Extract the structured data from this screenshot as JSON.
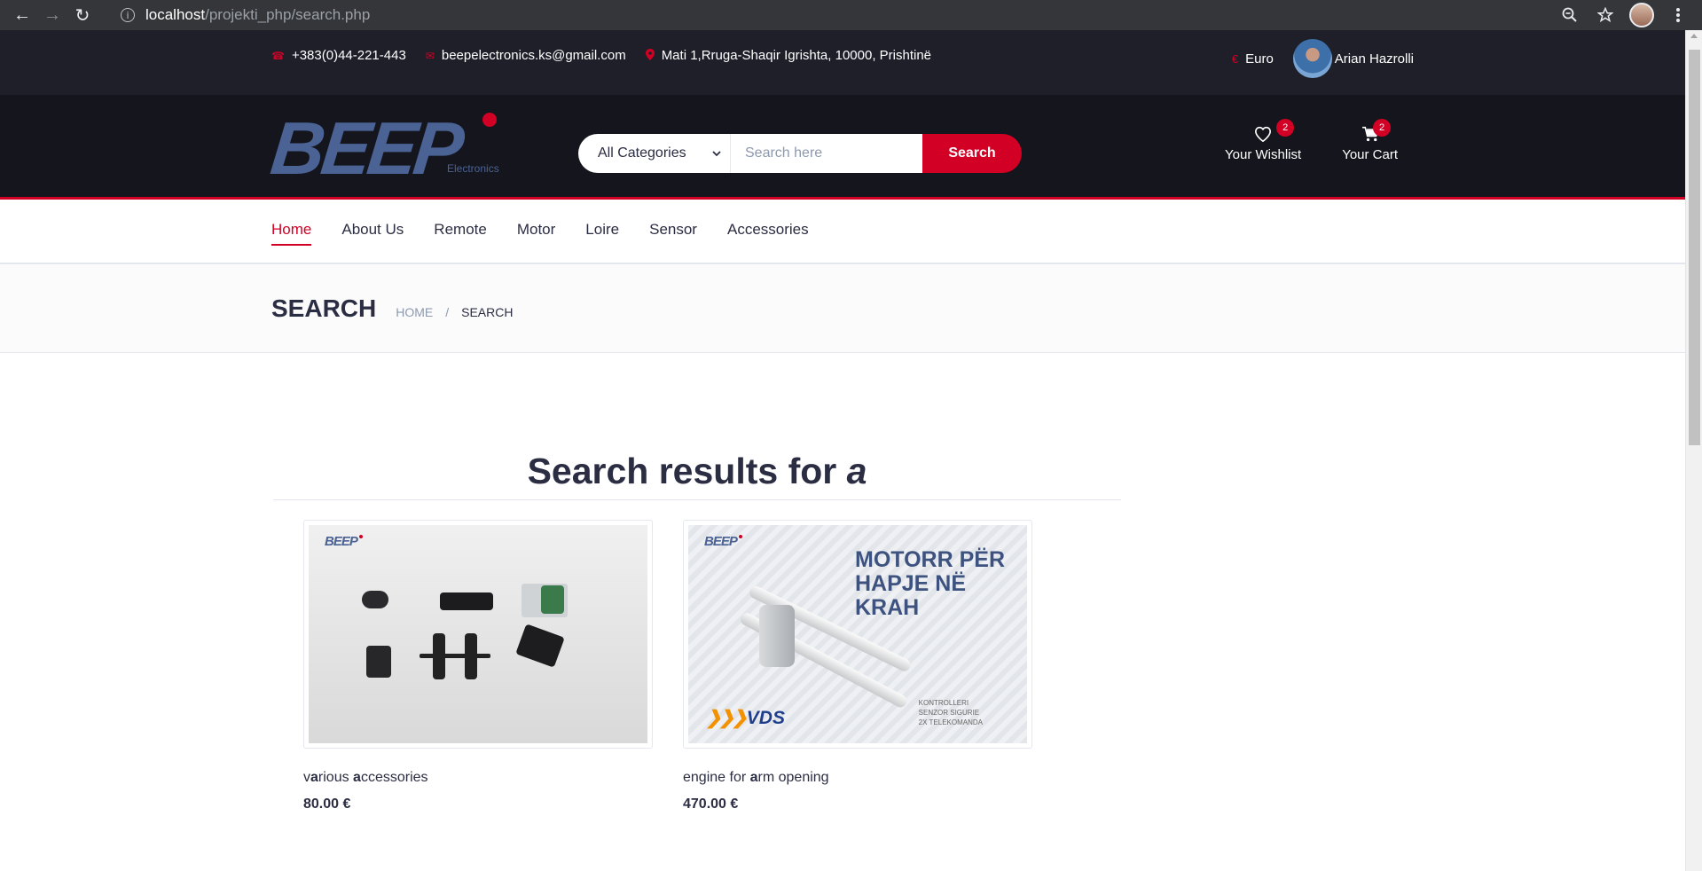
{
  "browser": {
    "url_host": "localhost",
    "url_path": "/projekti_php/search.php"
  },
  "top_header": {
    "phone": "+383(0)44-221-443",
    "email": "beepelectronics.ks@gmail.com",
    "address": "Mati 1,Rruga-Shaqir Igrishta, 10000, Prishtinë",
    "currency": "Euro",
    "currency_symbol": "€",
    "user_name": "Arian Hazrolli"
  },
  "logo": {
    "word": "BEEP",
    "sub": "Electronics"
  },
  "search": {
    "category": "All Categories",
    "placeholder": "Search here",
    "button": "Search"
  },
  "header_ctn": {
    "wishlist_label": "Your Wishlist",
    "wishlist_qty": "2",
    "cart_label": "Your Cart",
    "cart_qty": "2"
  },
  "nav": {
    "items": [
      "Home",
      "About Us",
      "Remote",
      "Motor",
      "Loire",
      "Sensor",
      "Accessories"
    ],
    "active": "Home"
  },
  "breadcrumb": {
    "title": "SEARCH",
    "home": "HOME",
    "separator": "/",
    "current": "SEARCH"
  },
  "results": {
    "heading": "Search results for ",
    "query": "a",
    "products": [
      {
        "name_parts": [
          [
            "v",
            false
          ],
          [
            "a",
            true
          ],
          [
            "rious ",
            false
          ],
          [
            "a",
            true
          ],
          [
            "ccessories",
            false
          ]
        ],
        "price": "80.00 €"
      },
      {
        "name_parts": [
          [
            "engine for ",
            false
          ],
          [
            "a",
            true
          ],
          [
            "rm opening",
            false
          ]
        ],
        "price": "470.00 €",
        "image_text": "MOTORR PËR HAPJE NË KRAH",
        "image_brand": "VDS",
        "image_notes": [
          "KONTROLLERI",
          "SENZOR SIGURIE",
          "2X TELEKOMANDA"
        ]
      }
    ]
  },
  "colors": {
    "accent": "#d10024",
    "dark": "#1e1f29",
    "darker": "#15161d",
    "text": "#2b2d42"
  }
}
